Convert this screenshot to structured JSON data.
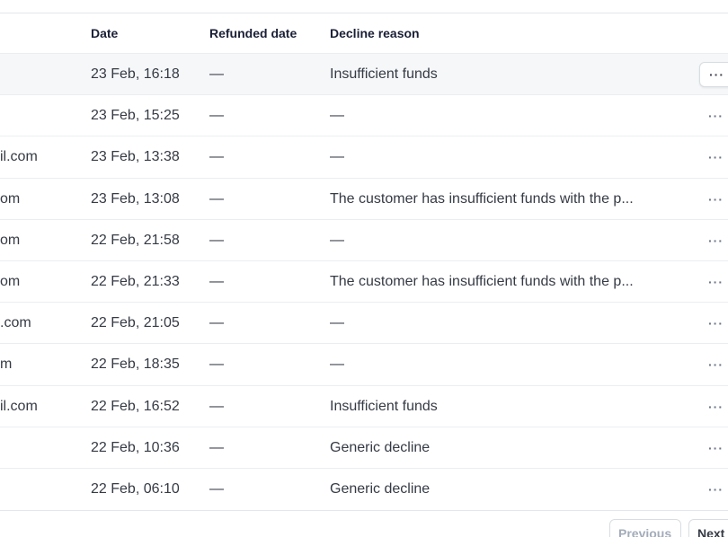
{
  "table": {
    "headers": {
      "date": "Date",
      "refunded": "Refunded date",
      "decline": "Decline reason"
    },
    "more_label": "···",
    "rows": [
      {
        "email": "",
        "date": "23 Feb, 16:18",
        "refunded": "—",
        "decline": "Insufficient funds"
      },
      {
        "email": "",
        "date": "23 Feb, 15:25",
        "refunded": "—",
        "decline": "—"
      },
      {
        "email": "il.com",
        "date": "23 Feb, 13:38",
        "refunded": "—",
        "decline": "—"
      },
      {
        "email": "om",
        "date": "23 Feb, 13:08",
        "refunded": "—",
        "decline": "The customer has insufficient funds with the p..."
      },
      {
        "email": "om",
        "date": "22 Feb, 21:58",
        "refunded": "—",
        "decline": "—"
      },
      {
        "email": "om",
        "date": "22 Feb, 21:33",
        "refunded": "—",
        "decline": "The customer has insufficient funds with the p..."
      },
      {
        "email": ".com",
        "date": "22 Feb, 21:05",
        "refunded": "—",
        "decline": "—"
      },
      {
        "email": "m",
        "date": "22 Feb, 18:35",
        "refunded": "—",
        "decline": "—"
      },
      {
        "email": "il.com",
        "date": "22 Feb, 16:52",
        "refunded": "—",
        "decline": "Insufficient funds"
      },
      {
        "email": "",
        "date": "22 Feb, 10:36",
        "refunded": "—",
        "decline": "Generic decline"
      },
      {
        "email": "",
        "date": "22 Feb, 06:10",
        "refunded": "—",
        "decline": "Generic decline"
      }
    ]
  },
  "pagination": {
    "previous_label": "Previous",
    "next_label": "Next"
  },
  "colors": {
    "header_text": "#1a1f36",
    "row_text": "#353a44",
    "highlight_row": "#f5f7f9",
    "border": "#ebeef1",
    "disabled_text": "#a3acba"
  }
}
